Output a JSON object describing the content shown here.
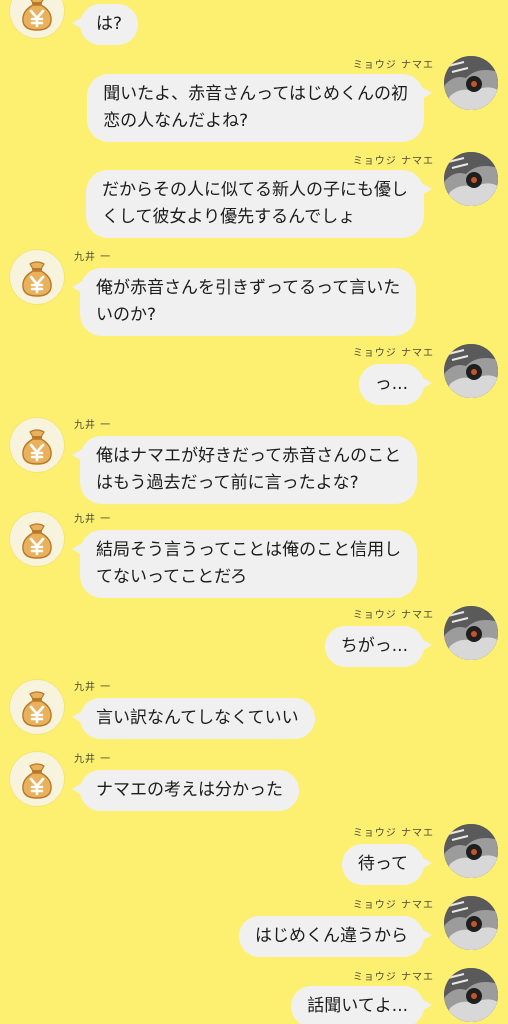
{
  "contacts": {
    "left_name": "九井 一",
    "right_name": "ミョウジ ナマエ"
  },
  "icons": {
    "left_avatar": "money-bag-yen-icon",
    "right_avatar": "photo-avatar-icon"
  },
  "colors": {
    "background": "#fdf071",
    "bubble": "#f0f0f0",
    "bag": "#e9b15c",
    "bag_dark": "#b9782a",
    "yen": "#ffffff"
  },
  "messages": [
    {
      "side": "left",
      "text": "は?"
    },
    {
      "side": "right",
      "sender": "ミョウジ ナマエ",
      "text": "聞いたよ、赤音さんってはじめくんの初\n恋の人なんだよね?"
    },
    {
      "side": "right",
      "sender": "ミョウジ ナマエ",
      "text": "だからその人に似てる新人の子にも優し\nくして彼女より優先するんでしょ"
    },
    {
      "side": "left",
      "sender": "九井 一",
      "text": "俺が赤音さんを引きずってるって言いた\nいのか?"
    },
    {
      "side": "right",
      "sender": "ミョウジ ナマエ",
      "text": "っ..."
    },
    {
      "side": "left",
      "sender": "九井 一",
      "text": "俺はナマエが好きだって赤音さんのこと\nはもう過去だって前に言ったよな?"
    },
    {
      "side": "left",
      "sender": "九井 一",
      "text": "結局そう言うってことは俺のこと信用し\nてないってことだろ"
    },
    {
      "side": "right",
      "sender": "ミョウジ ナマエ",
      "text": "ちがっ..."
    },
    {
      "side": "left",
      "sender": "九井 一",
      "text": "言い訳なんてしなくていい"
    },
    {
      "side": "left",
      "sender": "九井 一",
      "text": "ナマエの考えは分かった"
    },
    {
      "side": "right",
      "sender": "ミョウジ ナマエ",
      "text": "待って"
    },
    {
      "side": "right",
      "sender": "ミョウジ ナマエ",
      "text": "はじめくん違うから"
    },
    {
      "side": "right",
      "sender": "ミョウジ ナマエ",
      "text": "話聞いてよ..."
    }
  ]
}
